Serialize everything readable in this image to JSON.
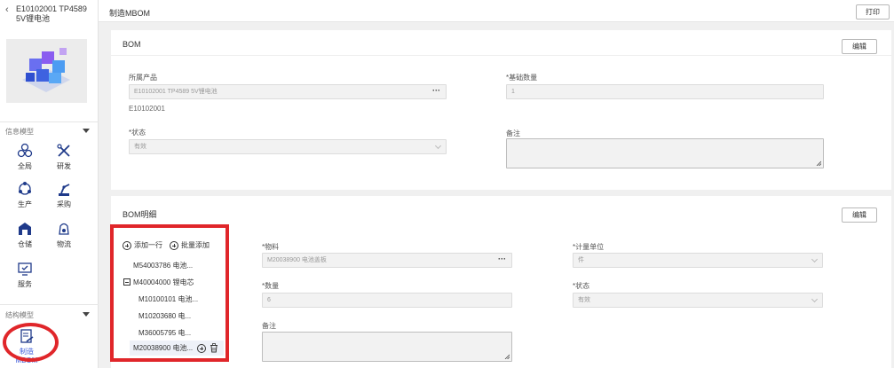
{
  "sidebar": {
    "back_icon": "chevron-left-icon",
    "product_title": "E10102001 TP4589 5V锂电池",
    "section_info": "信息模型",
    "info_items": [
      {
        "label": "全局",
        "icon": "nodes-icon"
      },
      {
        "label": "研发",
        "icon": "tools-icon"
      },
      {
        "label": "生产",
        "icon": "cycle-icon"
      },
      {
        "label": "采购",
        "icon": "robot-arm-icon"
      },
      {
        "label": "仓储",
        "icon": "warehouse-icon"
      },
      {
        "label": "物流",
        "icon": "logistics-icon"
      },
      {
        "label": "服务",
        "icon": "service-icon"
      }
    ],
    "section_structure": "结构模型",
    "structure_items": [
      {
        "label": "制造MBOM",
        "icon": "mbom-doc-icon"
      }
    ]
  },
  "header": {
    "title": "制造MBOM",
    "print_label": "打印"
  },
  "bom": {
    "title": "BOM",
    "edit_label": "编辑",
    "product_label": "所属产品",
    "product_value": "E10102001 TP4589 5V锂电池",
    "product_code": "E10102001",
    "base_qty_label": "*基础数量",
    "base_qty_value": "1",
    "status_label": "*状态",
    "status_value": "有效",
    "remark_label": "备注"
  },
  "detail": {
    "title": "BOM明细",
    "edit_label": "编辑",
    "add_row_label": "添加一行",
    "batch_add_label": "批量添加",
    "tree": [
      "M54003786 电池...",
      "M40004000 锂电芯",
      "M10100101 电池...",
      "M10203680 电...",
      "M36005795 电...",
      "M20038900 电池..."
    ],
    "material_label": "*物料",
    "material_value": "M20038900 电池盖板",
    "unit_label": "*计量单位",
    "unit_value": "件",
    "qty_label": "*数量",
    "qty_value": "6",
    "status_label": "*状态",
    "status_value": "有效",
    "remark_label": "备注"
  },
  "colors": {
    "highlight_red": "#e0262a",
    "selected_label_blue": "#3b5bdb"
  }
}
